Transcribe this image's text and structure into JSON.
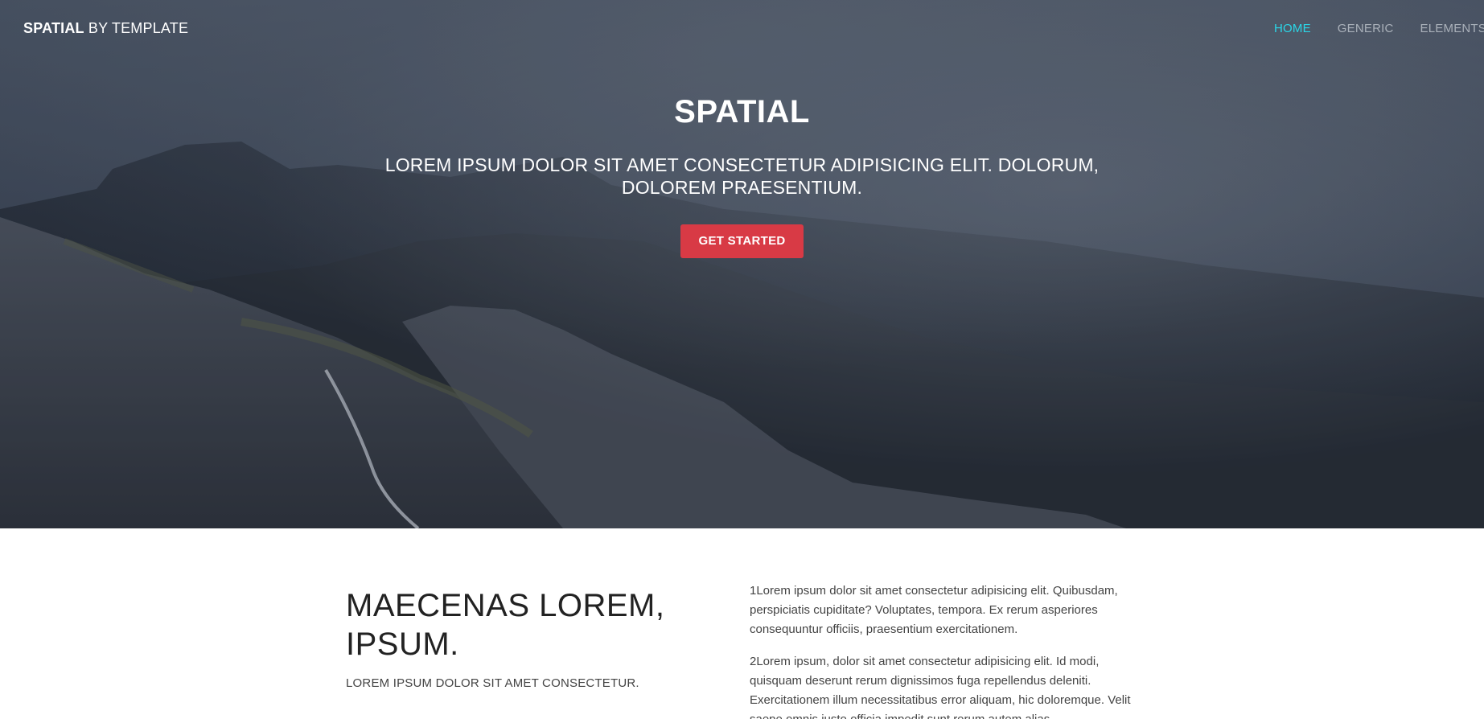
{
  "nav": {
    "brand_strong": "SPATIAL",
    "brand_rest": " BY TEMPLATE",
    "links": [
      {
        "label": "HOME",
        "active": true
      },
      {
        "label": "GENERIC",
        "active": false
      },
      {
        "label": "ELEMENTS",
        "active": false
      }
    ]
  },
  "hero": {
    "title": "SPATIAL",
    "subtitle": "LOREM IPSUM DOLOR SIT AMET CONSECTETUR ADIPISICING ELIT. DOLORUM, DOLOREM PRAESENTIUM.",
    "cta_label": "GET STARTED"
  },
  "section": {
    "title": "MAECENAS LOREM, IPSUM.",
    "subtitle": "LOREM IPSUM DOLOR SIT AMET CONSECTETUR.",
    "paragraphs": [
      "1Lorem ipsum dolor sit amet consectetur adipisicing elit. Quibusdam, perspiciatis cupiditate? Voluptates, tempora. Ex rerum asperiores consequuntur officiis, praesentium exercitationem.",
      "2Lorem ipsum, dolor sit amet consectetur adipisicing elit. Id modi, quisquam deserunt rerum dignissimos fuga repellendus deleniti. Exercitationem illum necessitatibus error aliquam, hic doloremque. Velit saepe omnis iusto officia impedit sunt rerum autem alias."
    ]
  },
  "colors": {
    "accent": "#2ad7e8",
    "cta": "#d83a45",
    "nav_inactive": "#aab1ba"
  }
}
